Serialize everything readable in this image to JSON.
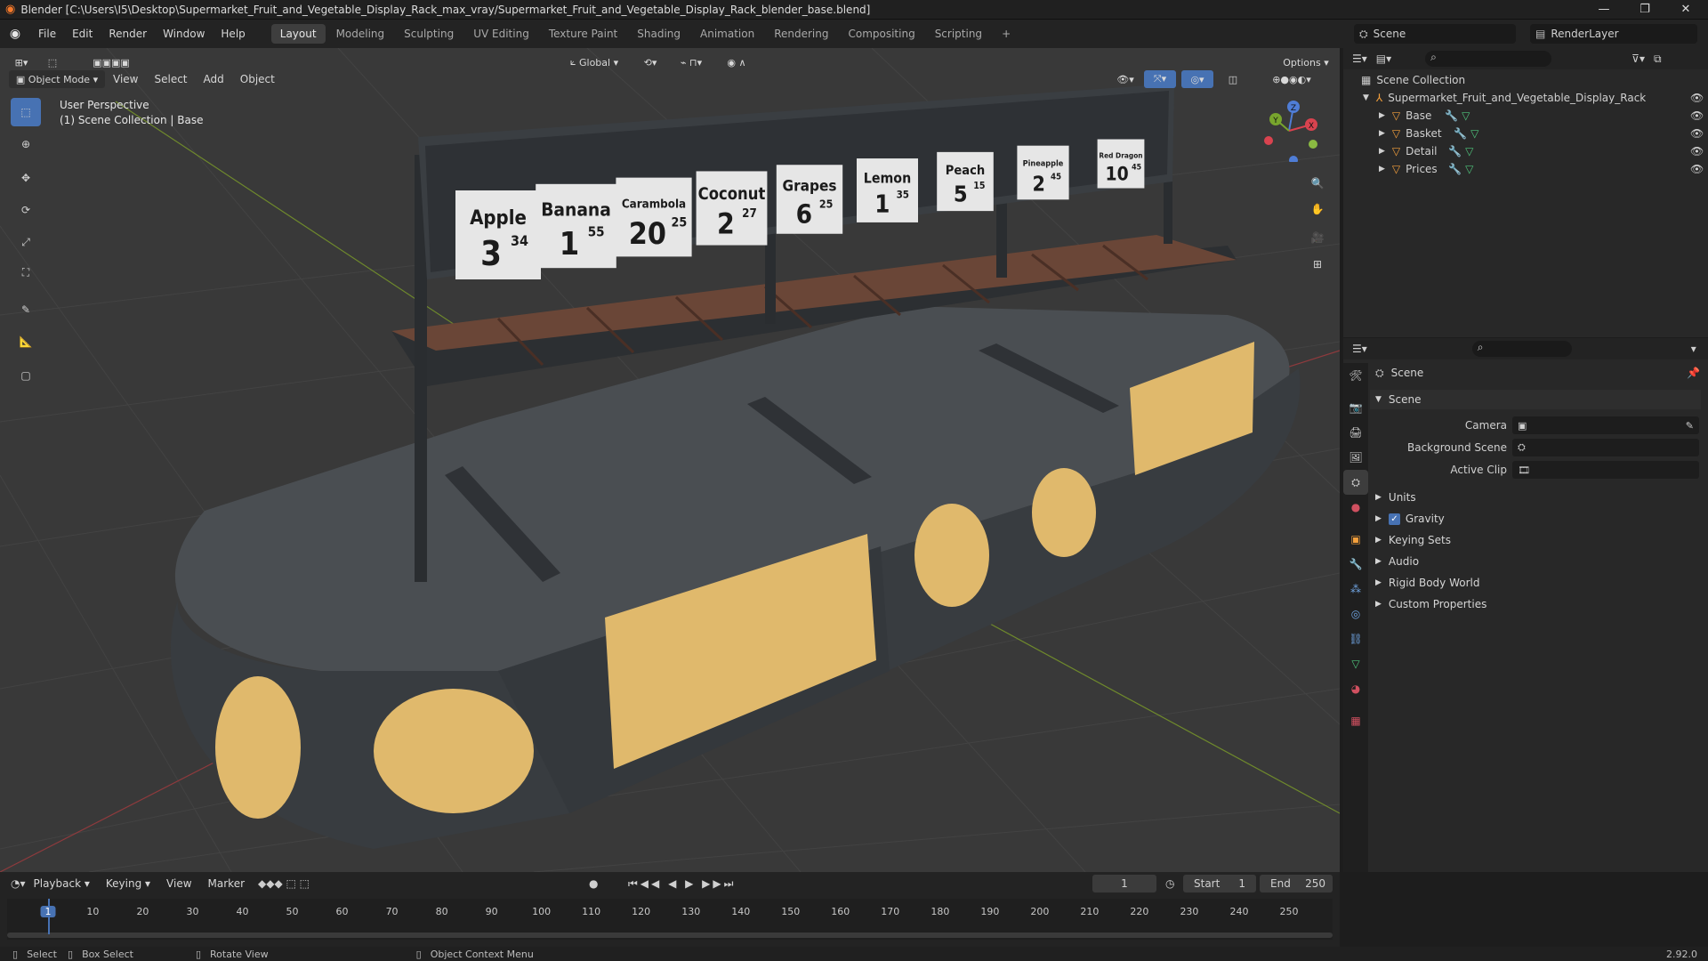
{
  "window": {
    "title": "Blender [C:\\Users\\I5\\Desktop\\Supermarket_Fruit_and_Vegetable_Display_Rack_max_vray/Supermarket_Fruit_and_Vegetable_Display_Rack_blender_base.blend]"
  },
  "menu": [
    "File",
    "Edit",
    "Render",
    "Window",
    "Help"
  ],
  "workspaces": [
    "Layout",
    "Modeling",
    "Sculpting",
    "UV Editing",
    "Texture Paint",
    "Shading",
    "Animation",
    "Rendering",
    "Compositing",
    "Scripting"
  ],
  "scene_selector": {
    "scene": "Scene",
    "view_layer": "RenderLayer"
  },
  "viewport": {
    "mode": "Object Mode",
    "menus": [
      "View",
      "Select",
      "Add",
      "Object"
    ],
    "transform_orientation": "Global",
    "options": "Options",
    "overlay_line1": "User Perspective",
    "overlay_line2": "(1) Scene Collection | Base",
    "gizmo_axes": {
      "x": "X",
      "y": "Y",
      "z": "Z"
    }
  },
  "signs": [
    {
      "name": "Apple",
      "big": "3",
      "small": "34"
    },
    {
      "name": "Banana",
      "big": "1",
      "small": "55"
    },
    {
      "name": "Carambola",
      "big": "20",
      "small": "25"
    },
    {
      "name": "Coconut",
      "big": "2",
      "small": "27"
    },
    {
      "name": "Grapes",
      "big": "6",
      "small": "25"
    },
    {
      "name": "Lemon",
      "big": "1",
      "small": "35"
    },
    {
      "name": "Peach",
      "big": "5",
      "small": "15"
    },
    {
      "name": "Pineapple",
      "big": "2",
      "small": "45"
    },
    {
      "name": "Red Dragon",
      "big": "10",
      "small": "45"
    }
  ],
  "outliner": {
    "root": "Scene Collection",
    "collection": "Supermarket_Fruit_and_Vegetable_Display_Rack",
    "objects": [
      "Base",
      "Basket",
      "Detail",
      "Prices"
    ]
  },
  "properties": {
    "context": "Scene",
    "panel": "Scene",
    "fields": [
      {
        "label": "Camera"
      },
      {
        "label": "Background Scene"
      },
      {
        "label": "Active Clip"
      }
    ],
    "subpanels": [
      "Units",
      "Gravity",
      "Keying Sets",
      "Audio",
      "Rigid Body World",
      "Custom Properties"
    ],
    "gravity_checked": true
  },
  "timeline": {
    "menus": [
      "Playback",
      "Keying",
      "View",
      "Marker"
    ],
    "current_frame": "1",
    "start_label": "Start",
    "start": "1",
    "end_label": "End",
    "end": "250",
    "ticks": [
      "1",
      "10",
      "20",
      "30",
      "40",
      "50",
      "60",
      "70",
      "80",
      "90",
      "100",
      "110",
      "120",
      "130",
      "140",
      "150",
      "160",
      "170",
      "180",
      "190",
      "200",
      "210",
      "220",
      "230",
      "240",
      "250"
    ]
  },
  "status": {
    "select": "Select",
    "box_select": "Box Select",
    "rotate": "Rotate View",
    "context_menu": "Object Context Menu",
    "version": "2.92.0"
  },
  "colors": {
    "accent": "#4772b3",
    "viewport_bg": "#393939",
    "panel_bg": "#282828",
    "wood": "#e0b96c",
    "counter": "#3f4347",
    "basket": "#6a4637"
  }
}
